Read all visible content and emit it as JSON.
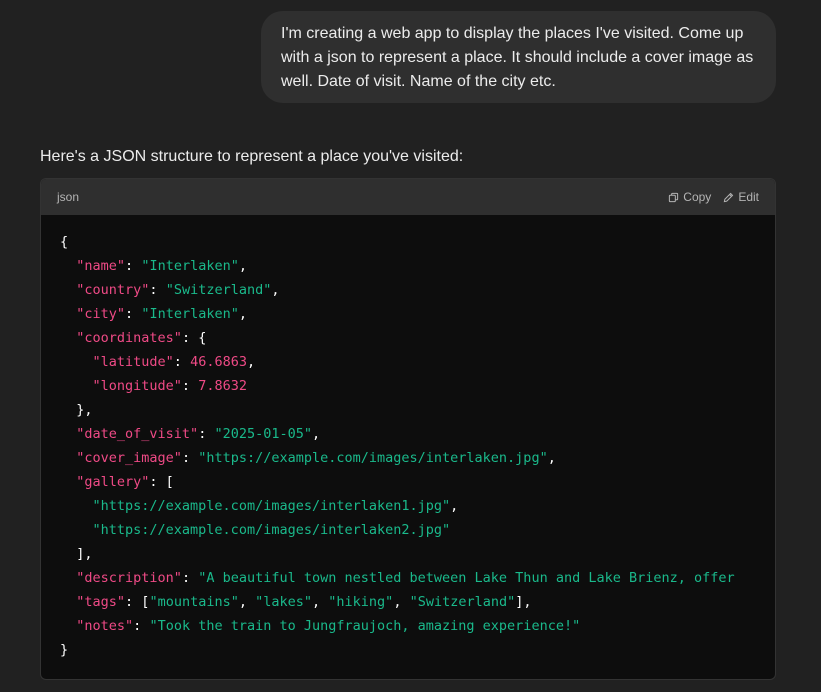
{
  "conversation": {
    "user_message": "I'm creating a web app to display the places I've visited. Come up with a json to represent a place. It should include a cover image as well. Date of visit. Name of the city etc.",
    "assistant_intro": "Here's a JSON structure to represent a place you've visited:"
  },
  "code_block": {
    "language": "json",
    "copy_label": "Copy",
    "edit_label": "Edit",
    "lines": [
      [
        {
          "t": "p",
          "v": "{"
        }
      ],
      [
        {
          "t": "p",
          "v": "  "
        },
        {
          "t": "k",
          "v": "\"name\""
        },
        {
          "t": "p",
          "v": ": "
        },
        {
          "t": "s",
          "v": "\"Interlaken\""
        },
        {
          "t": "p",
          "v": ","
        }
      ],
      [
        {
          "t": "p",
          "v": "  "
        },
        {
          "t": "k",
          "v": "\"country\""
        },
        {
          "t": "p",
          "v": ": "
        },
        {
          "t": "s",
          "v": "\"Switzerland\""
        },
        {
          "t": "p",
          "v": ","
        }
      ],
      [
        {
          "t": "p",
          "v": "  "
        },
        {
          "t": "k",
          "v": "\"city\""
        },
        {
          "t": "p",
          "v": ": "
        },
        {
          "t": "s",
          "v": "\"Interlaken\""
        },
        {
          "t": "p",
          "v": ","
        }
      ],
      [
        {
          "t": "p",
          "v": "  "
        },
        {
          "t": "k",
          "v": "\"coordinates\""
        },
        {
          "t": "p",
          "v": ": {"
        }
      ],
      [
        {
          "t": "p",
          "v": "    "
        },
        {
          "t": "k",
          "v": "\"latitude\""
        },
        {
          "t": "p",
          "v": ": "
        },
        {
          "t": "n",
          "v": "46.6863"
        },
        {
          "t": "p",
          "v": ","
        }
      ],
      [
        {
          "t": "p",
          "v": "    "
        },
        {
          "t": "k",
          "v": "\"longitude\""
        },
        {
          "t": "p",
          "v": ": "
        },
        {
          "t": "n",
          "v": "7.8632"
        }
      ],
      [
        {
          "t": "p",
          "v": "  },"
        }
      ],
      [
        {
          "t": "p",
          "v": "  "
        },
        {
          "t": "k",
          "v": "\"date_of_visit\""
        },
        {
          "t": "p",
          "v": ": "
        },
        {
          "t": "s",
          "v": "\"2025-01-05\""
        },
        {
          "t": "p",
          "v": ","
        }
      ],
      [
        {
          "t": "p",
          "v": "  "
        },
        {
          "t": "k",
          "v": "\"cover_image\""
        },
        {
          "t": "p",
          "v": ": "
        },
        {
          "t": "s",
          "v": "\"https://example.com/images/interlaken.jpg\""
        },
        {
          "t": "p",
          "v": ","
        }
      ],
      [
        {
          "t": "p",
          "v": "  "
        },
        {
          "t": "k",
          "v": "\"gallery\""
        },
        {
          "t": "p",
          "v": ": ["
        }
      ],
      [
        {
          "t": "p",
          "v": "    "
        },
        {
          "t": "s",
          "v": "\"https://example.com/images/interlaken1.jpg\""
        },
        {
          "t": "p",
          "v": ","
        }
      ],
      [
        {
          "t": "p",
          "v": "    "
        },
        {
          "t": "s",
          "v": "\"https://example.com/images/interlaken2.jpg\""
        }
      ],
      [
        {
          "t": "p",
          "v": "  ],"
        }
      ],
      [
        {
          "t": "p",
          "v": "  "
        },
        {
          "t": "k",
          "v": "\"description\""
        },
        {
          "t": "p",
          "v": ": "
        },
        {
          "t": "s",
          "v": "\"A beautiful town nestled between Lake Thun and Lake Brienz, offer"
        }
      ],
      [
        {
          "t": "p",
          "v": "  "
        },
        {
          "t": "k",
          "v": "\"tags\""
        },
        {
          "t": "p",
          "v": ": ["
        },
        {
          "t": "s",
          "v": "\"mountains\""
        },
        {
          "t": "p",
          "v": ", "
        },
        {
          "t": "s",
          "v": "\"lakes\""
        },
        {
          "t": "p",
          "v": ", "
        },
        {
          "t": "s",
          "v": "\"hiking\""
        },
        {
          "t": "p",
          "v": ", "
        },
        {
          "t": "s",
          "v": "\"Switzerland\""
        },
        {
          "t": "p",
          "v": "],"
        }
      ],
      [
        {
          "t": "p",
          "v": "  "
        },
        {
          "t": "k",
          "v": "\"notes\""
        },
        {
          "t": "p",
          "v": ": "
        },
        {
          "t": "s",
          "v": "\"Took the train to Jungfraujoch, amazing experience!\""
        }
      ],
      [
        {
          "t": "p",
          "v": "}"
        }
      ]
    ]
  },
  "icons": {
    "copy": "copy-icon",
    "edit": "edit-pencil-icon"
  },
  "colors": {
    "background": "#212121",
    "user_bubble": "#2f2f2f",
    "code_background": "#0d0d0d",
    "code_header": "#2f2f2f",
    "json_key": "#ef4a86",
    "json_string": "#1ab98b",
    "json_number": "#ef4a86"
  }
}
